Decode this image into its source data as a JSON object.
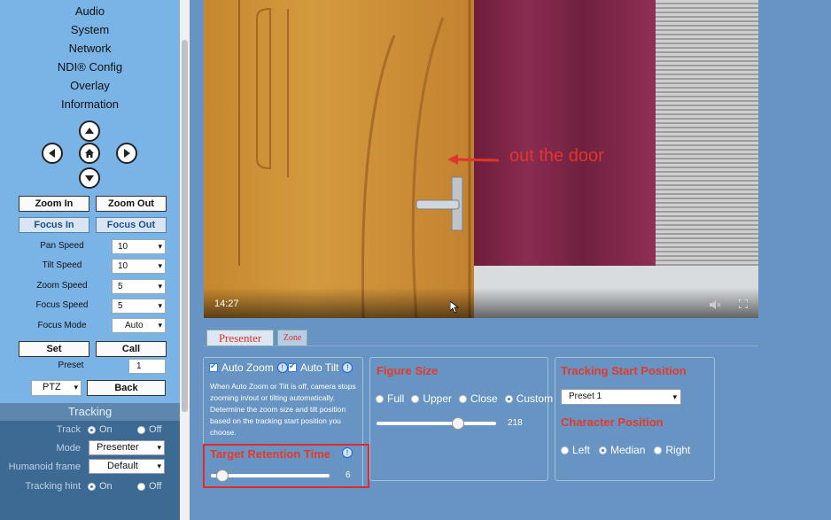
{
  "menu": [
    "Audio",
    "System",
    "Network",
    "NDI® Config",
    "Overlay",
    "Information"
  ],
  "ptz": {
    "up": "arrow-up",
    "left": "arrow-left",
    "home": "home",
    "right": "arrow-right",
    "down": "arrow-down"
  },
  "buttons": {
    "zoom_in": "Zoom In",
    "zoom_out": "Zoom Out",
    "focus_in": "Focus In",
    "focus_out": "Focus Out",
    "set": "Set",
    "call": "Call",
    "back": "Back"
  },
  "speeds": [
    {
      "label": "Pan Speed",
      "value": "10"
    },
    {
      "label": "Tilt Speed",
      "value": "10"
    },
    {
      "label": "Zoom Speed",
      "value": "5"
    },
    {
      "label": "Focus Speed",
      "value": "5"
    },
    {
      "label": "Focus Mode",
      "value": "Auto"
    }
  ],
  "preset": {
    "label": "Preset",
    "value": "1",
    "mode_value": "PTZ"
  },
  "tracking": {
    "header": "Tracking",
    "track_label": "Track",
    "track_on": "On",
    "track_off": "Off",
    "mode_label": "Mode",
    "mode_value": "Presenter",
    "humanoid_label": "Humanoid frame",
    "humanoid_value": "Default",
    "hint_label": "Tracking hint",
    "hint_on": "On",
    "hint_off": "Off"
  },
  "video": {
    "time": "14:27",
    "annotation": "out the door"
  },
  "tabs": [
    "Presenter",
    "Zone"
  ],
  "auto_panel": {
    "auto_zoom": "Auto Zoom",
    "auto_tilt": "Auto Tilt",
    "description": "When Auto Zoom or Tilt is off, camera stops zooming in/out or tilting automatically. Determine the zoom size and tilt position based on the tracking start position you choose.",
    "retention_title": "Target Retention Time",
    "retention_value": "6",
    "retention_fraction": 0.1
  },
  "figure_panel": {
    "title": "Figure Size",
    "options": [
      "Full",
      "Upper",
      "Close",
      "Custom"
    ],
    "selected": "Custom",
    "value": "218",
    "fraction": 0.68
  },
  "tracking_panel": {
    "start_title": "Tracking Start Position",
    "start_value": "Preset 1",
    "char_title": "Character Position",
    "options": [
      "Left",
      "Median",
      "Right"
    ],
    "selected": "Median"
  },
  "colors": {
    "sidebar": "#7ab3e6",
    "main": "#6794c2",
    "title_red": "#e23a2b",
    "highlight": "#e02a2a"
  }
}
